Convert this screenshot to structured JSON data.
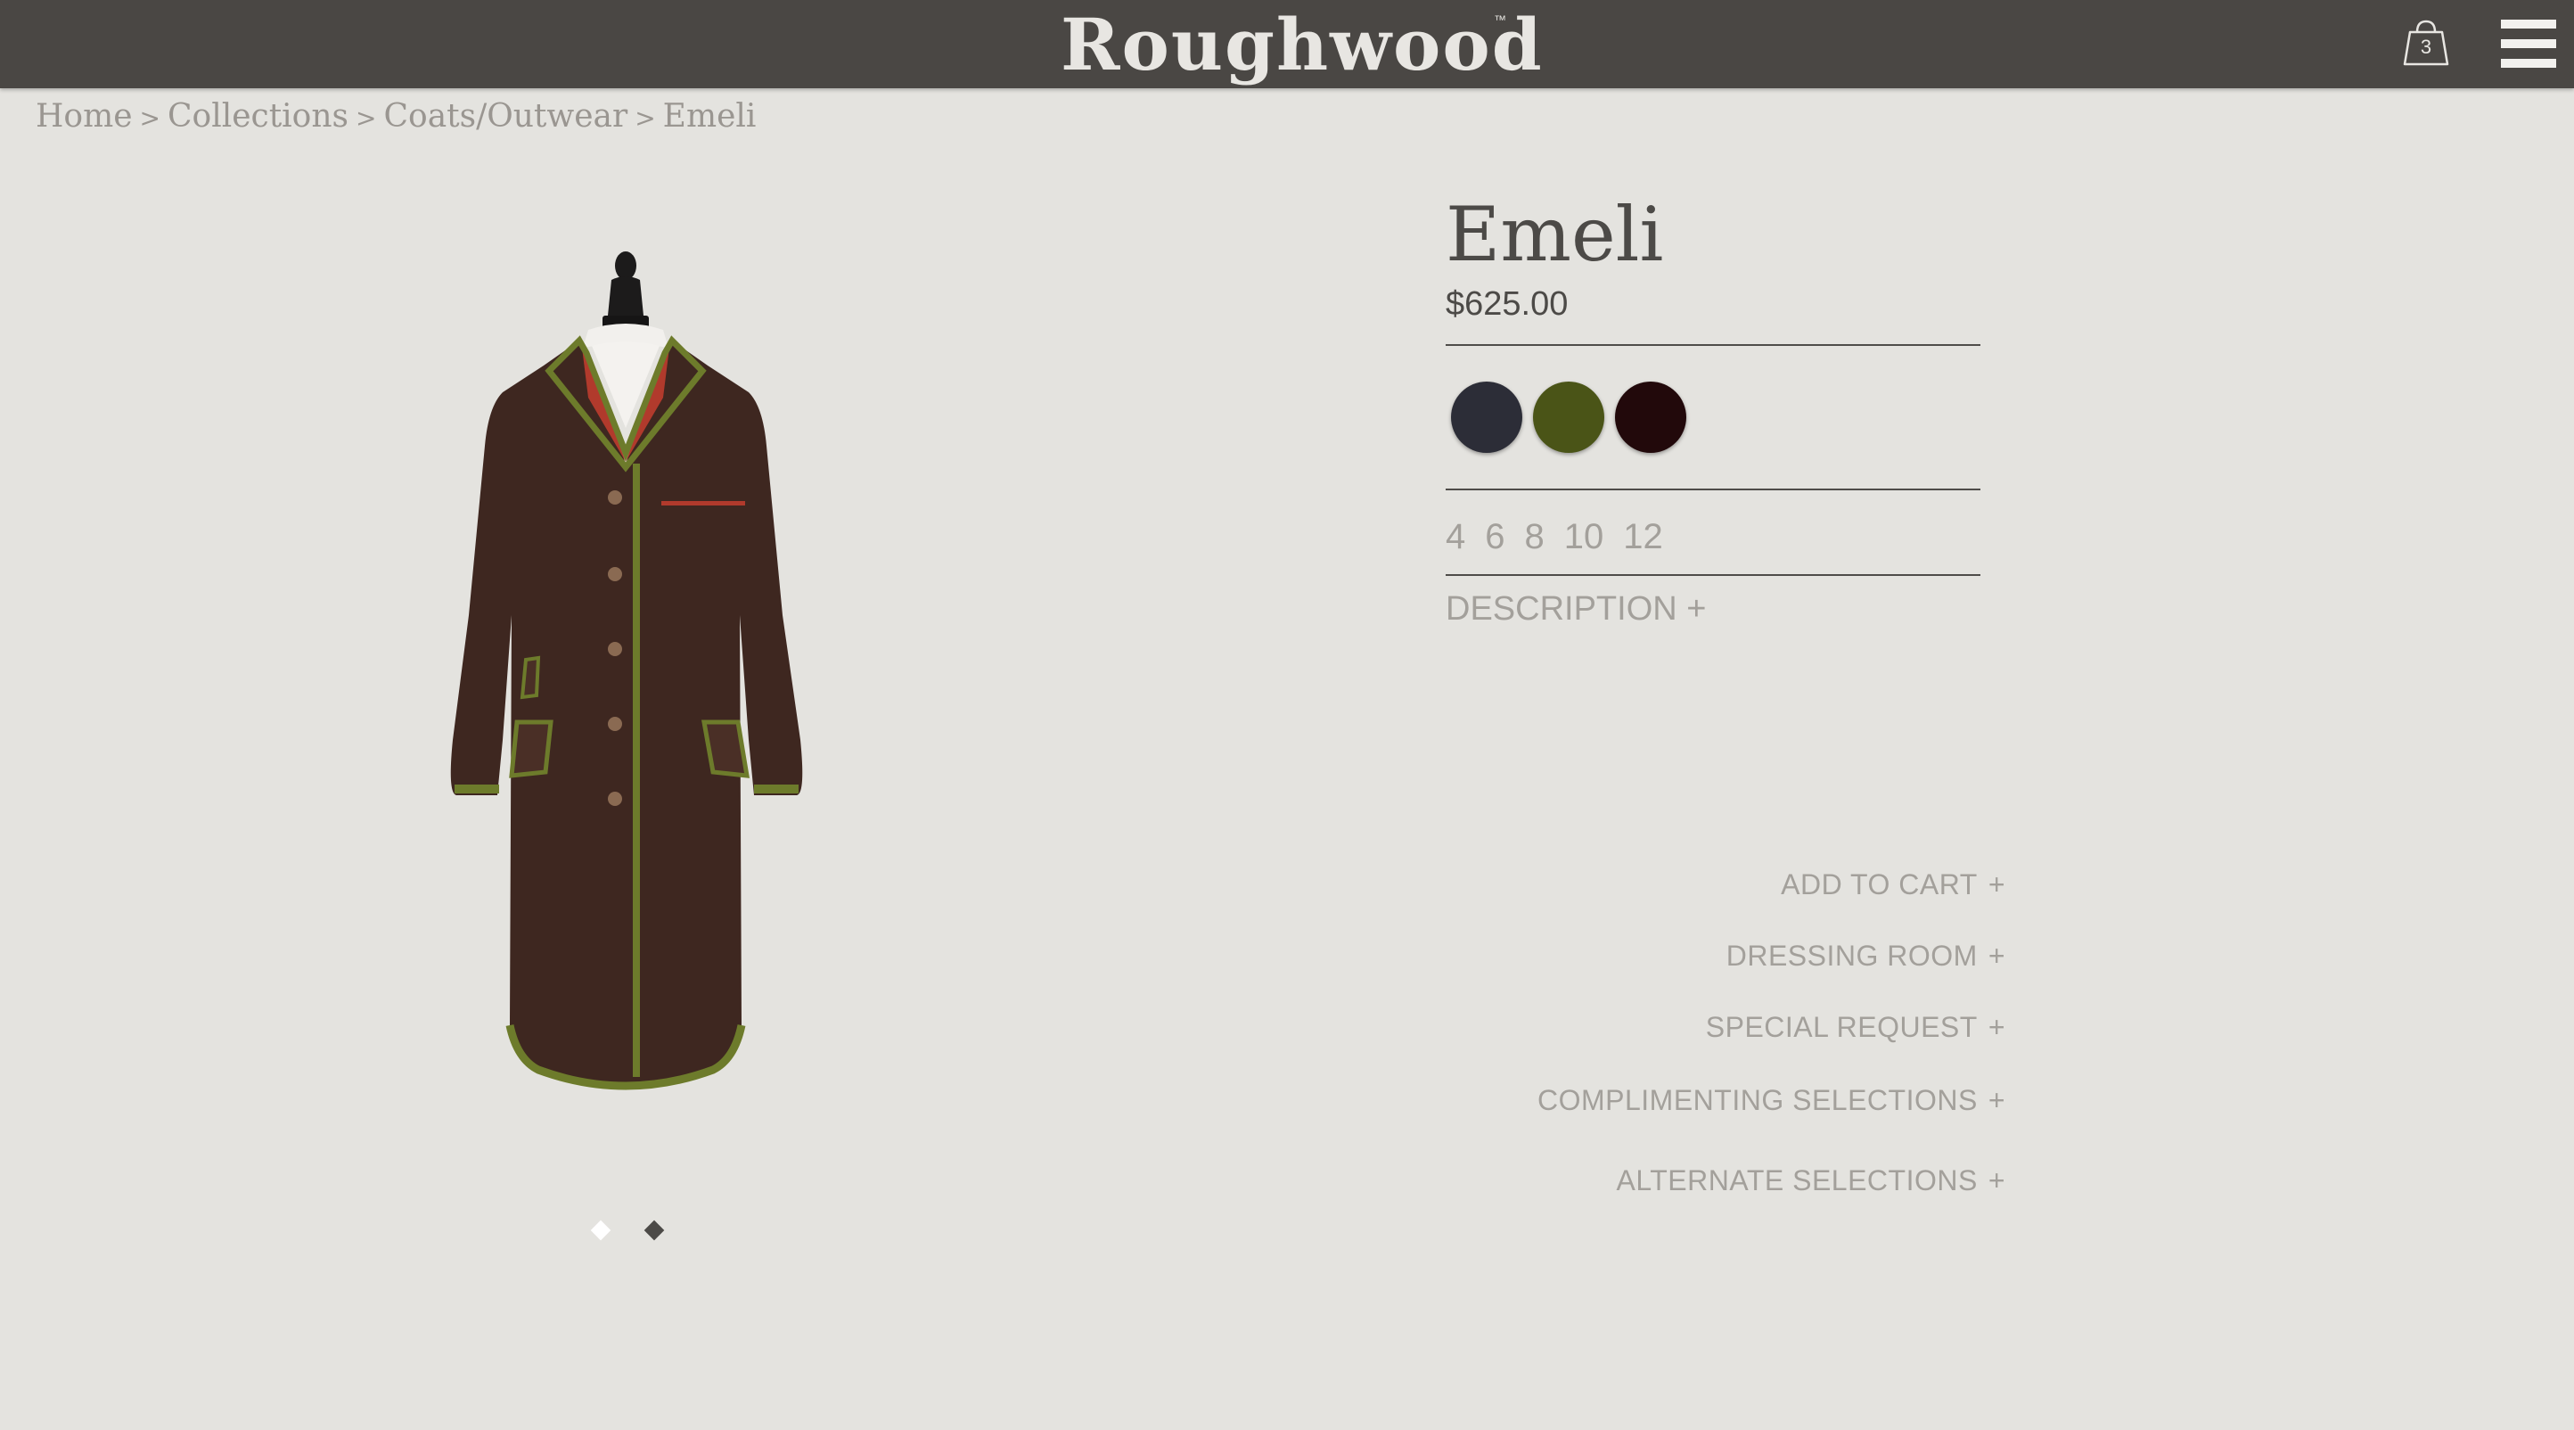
{
  "header": {
    "brand": "Roughwood",
    "trademark": "™",
    "cart_count": "3",
    "cart_icon": "shopping-bag-icon",
    "menu_icon": "hamburger-menu-icon"
  },
  "breadcrumb": {
    "items": [
      "Home",
      "Collections",
      "Coats/Outwear",
      "Emeli"
    ],
    "separator": ">"
  },
  "product": {
    "name": "Emeli",
    "price": "$625.00",
    "colors": [
      "#2c2d37",
      "#4a5417",
      "#22090b"
    ],
    "sizes": [
      "4",
      "6",
      "8",
      "10",
      "12"
    ],
    "description_label": "DESCRIPTION",
    "description_icon": "+",
    "image_count": 2,
    "active_image": 1
  },
  "actions": {
    "add_to_cart": "ADD TO CART",
    "dressing_room": "DRESSING ROOM",
    "special_request": "SPECIAL REQUEST",
    "complimenting": "COMPLIMENTING SELECTIONS",
    "alternate": "ALTERNATE SELECTIONS",
    "plus": "+"
  },
  "colors": {
    "header_bg": "#4a4744",
    "page_bg": "#e4e3df",
    "text_dark": "#4c4a47",
    "text_muted": "#a3a09b"
  }
}
